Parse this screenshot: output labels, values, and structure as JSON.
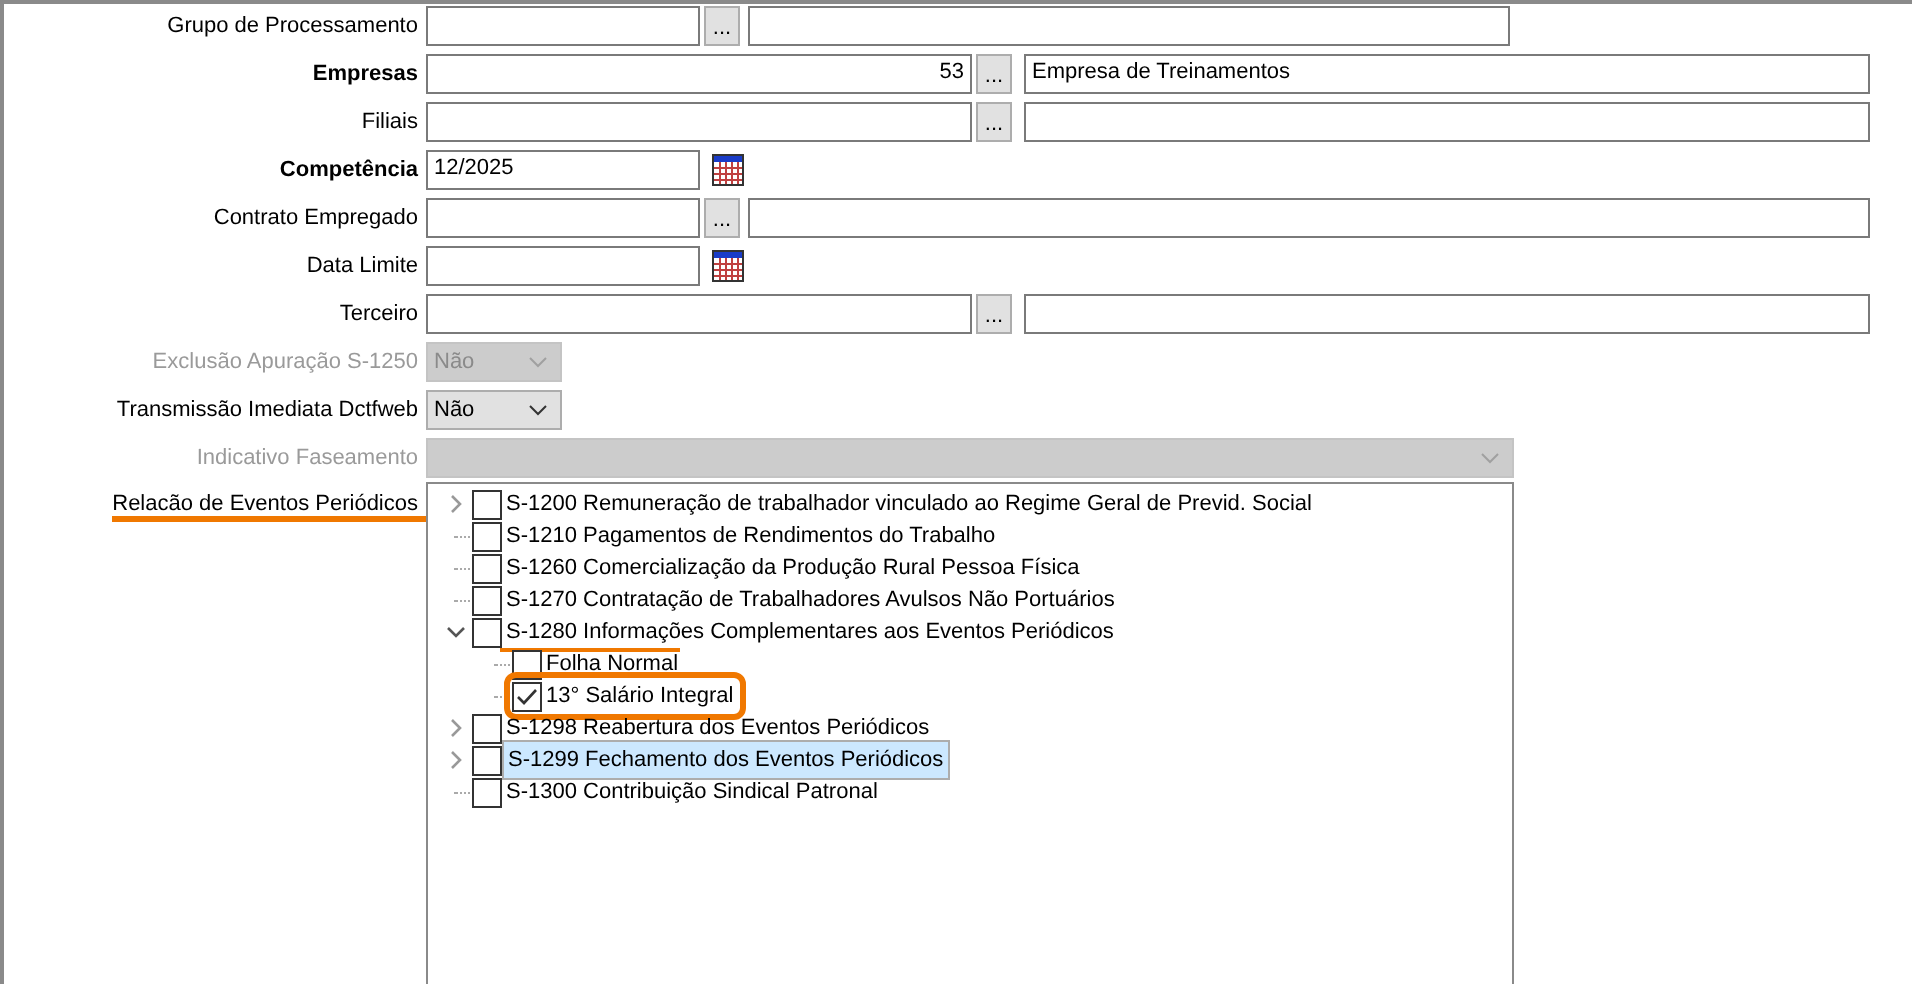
{
  "form": {
    "rows": [
      {
        "kind": "lookup",
        "label": "Grupo de Processamento",
        "bold": false,
        "disabled": false,
        "code": "",
        "button": "...",
        "description": ""
      },
      {
        "kind": "lookup",
        "label": "Empresas",
        "bold": true,
        "disabled": false,
        "code": "53",
        "button": "...",
        "description": "Empresa de Treinamentos"
      },
      {
        "kind": "lookup",
        "label": "Filiais",
        "bold": false,
        "disabled": false,
        "code": "",
        "button": "...",
        "description": ""
      },
      {
        "kind": "date",
        "label": "Competência",
        "bold": true,
        "disabled": false,
        "value": "12/2025"
      },
      {
        "kind": "lookup",
        "label": "Contrato Empregado",
        "bold": false,
        "disabled": false,
        "code": "",
        "button": "...",
        "description": ""
      },
      {
        "kind": "date",
        "label": "Data Limite",
        "bold": false,
        "disabled": false,
        "value": ""
      },
      {
        "kind": "lookup",
        "label": "Terceiro",
        "bold": false,
        "disabled": false,
        "code": "",
        "button": "...",
        "description": ""
      },
      {
        "kind": "select",
        "label": "Exclusão Apuração S-1250",
        "bold": false,
        "disabled": true,
        "value": "Não"
      },
      {
        "kind": "select",
        "label": "Transmissão Imediata Dctfweb",
        "bold": false,
        "disabled": false,
        "value": "Não"
      },
      {
        "kind": "select",
        "label": "Indicativo Faseamento",
        "bold": false,
        "disabled": true,
        "value": ""
      }
    ]
  },
  "events": {
    "label": "Relacão de Eventos Periódicos",
    "label_underlined": true,
    "items": [
      {
        "kind": "branch",
        "expanded": false,
        "checked": false,
        "selected": false,
        "underlined": false,
        "boxed": false,
        "text": "S-1200 Remuneração de trabalhador vinculado ao Regime Geral de Previd. Social"
      },
      {
        "kind": "leaf",
        "checked": false,
        "selected": false,
        "underlined": false,
        "boxed": false,
        "text": "S-1210 Pagamentos de Rendimentos do Trabalho"
      },
      {
        "kind": "leaf",
        "checked": false,
        "selected": false,
        "underlined": false,
        "boxed": false,
        "text": "S-1260 Comercialização da Produção Rural Pessoa Física"
      },
      {
        "kind": "leaf",
        "checked": false,
        "selected": false,
        "underlined": false,
        "boxed": false,
        "text": "S-1270 Contratação de Trabalhadores Avulsos Não Portuários"
      },
      {
        "kind": "branch",
        "expanded": true,
        "checked": false,
        "selected": false,
        "underlined": true,
        "boxed": false,
        "text": "S-1280 Informações Complementares aos Eventos Periódicos",
        "children": [
          {
            "kind": "leaf",
            "checked": false,
            "selected": false,
            "underlined": false,
            "boxed": false,
            "text": "Folha Normal"
          },
          {
            "kind": "leaf",
            "checked": true,
            "selected": false,
            "underlined": false,
            "boxed": true,
            "text": "13° Salário Integral"
          }
        ]
      },
      {
        "kind": "branch",
        "expanded": false,
        "checked": false,
        "selected": false,
        "underlined": false,
        "boxed": false,
        "text": "S-1298 Reabertura dos Eventos Periódicos"
      },
      {
        "kind": "branch",
        "expanded": false,
        "checked": false,
        "selected": true,
        "underlined": false,
        "boxed": false,
        "text": "S-1299 Fechamento dos Eventos Periódicos"
      },
      {
        "kind": "leaf",
        "checked": false,
        "selected": false,
        "underlined": false,
        "boxed": false,
        "text": "S-1300 Contribuição Sindical Patronal"
      }
    ]
  }
}
